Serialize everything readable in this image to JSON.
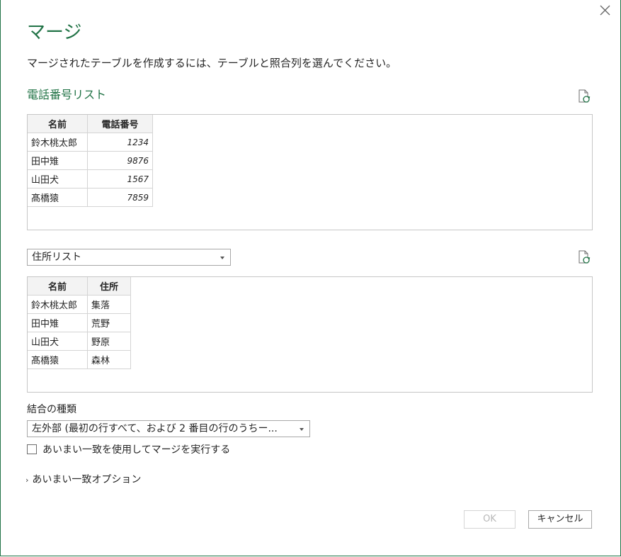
{
  "dialog": {
    "title": "マージ",
    "description": "マージされたテーブルを作成するには、テーブルと照合列を選んでください。"
  },
  "table1": {
    "name": "電話番号リスト",
    "columns": [
      "名前",
      "電話番号"
    ],
    "rows": [
      [
        "鈴木桃太郎",
        "1234"
      ],
      [
        "田中雉",
        "9876"
      ],
      [
        "山田犬",
        "1567"
      ],
      [
        "髙橋猿",
        "7859"
      ]
    ]
  },
  "table2": {
    "selected": "住所リスト",
    "columns": [
      "名前",
      "住所"
    ],
    "rows": [
      [
        "鈴木桃太郎",
        "集落"
      ],
      [
        "田中雉",
        "荒野"
      ],
      [
        "山田犬",
        "野原"
      ],
      [
        "髙橋猿",
        "森林"
      ]
    ]
  },
  "join": {
    "label": "結合の種類",
    "selected": "左外部 (最初の行すべて、および 2 番目の行のうちー..."
  },
  "fuzzy": {
    "checkbox_label": "あいまい一致を使用してマージを実行する",
    "checked": false,
    "options_label": "あいまい一致オプション"
  },
  "buttons": {
    "ok": "OK",
    "cancel": "キャンセル"
  },
  "colors": {
    "accent": "#217346"
  }
}
